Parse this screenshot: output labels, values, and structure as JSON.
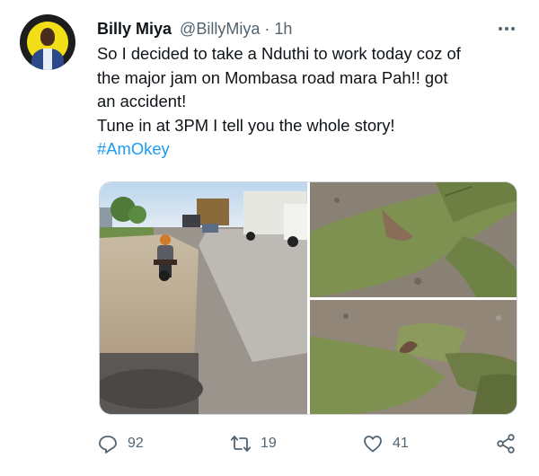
{
  "author": {
    "name": "Billy Miya",
    "handle": "@BillyMiya",
    "separator": "·",
    "time": "1h"
  },
  "tweet": {
    "lines": [
      "So I decided to take a Nduthi to work today coz of",
      "the major jam on Mombasa road mara Pah!! got",
      "an accident!",
      "Tune in at 3PM I tell you the whole story!"
    ],
    "hashtag": "#AmOkey"
  },
  "media": {
    "photos": [
      "road-with-motorbike-and-trucks-photo",
      "torn-green-trousers-photo",
      "green-trousers-and-boots-photo"
    ]
  },
  "actions": {
    "reply_count": "92",
    "retweet_count": "19",
    "like_count": "41"
  },
  "icons": [
    "more-icon",
    "reply-icon",
    "retweet-icon",
    "like-icon",
    "share-icon"
  ],
  "colors": {
    "text": "#0f1419",
    "secondary": "#536471",
    "link": "#1d9bf0",
    "border": "#cfd9de"
  }
}
